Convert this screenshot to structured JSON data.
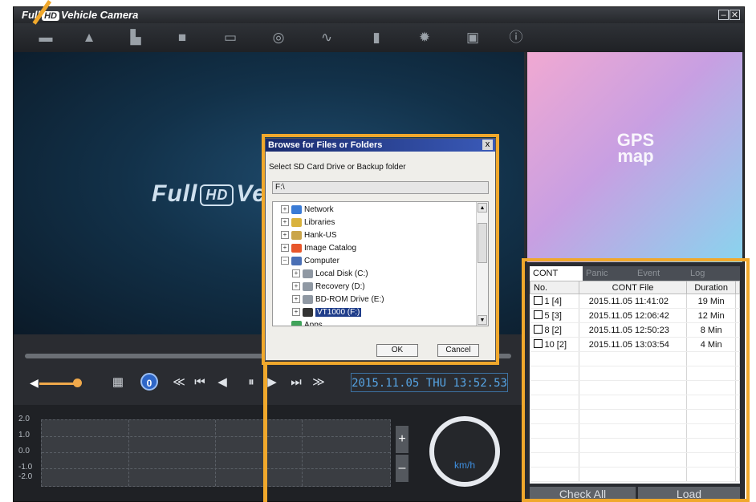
{
  "app": {
    "title_prefix": "Full",
    "title_hd": "HD",
    "title_suffix": "Vehicle Camera",
    "minimize_glyph": "–",
    "close_glyph": "✕"
  },
  "toolbar": {
    "icons": [
      "folder-icon",
      "image-icon",
      "printer-icon",
      "video-icon",
      "drive-icon",
      "globe-icon",
      "waveform-icon",
      "book-icon",
      "gear-icon",
      "photo-icon",
      "info-icon"
    ],
    "glyphs": [
      "▬",
      "▲",
      "▙",
      "■",
      "▭",
      "◎",
      "∿",
      "▮",
      "✹",
      "▣",
      "ⓘ"
    ]
  },
  "video": {
    "logo_prefix": "Full",
    "logo_hd": "HD",
    "logo_suffix": "Vehi"
  },
  "gps": {
    "label": "GPS\nmap"
  },
  "player": {
    "speed_badge": "0",
    "glyphs": {
      "volume": "◀",
      "snapshot": "▦",
      "rewind": "≪",
      "prev": "⏮",
      "step_back": "◀",
      "pause": "⏸",
      "play": "▶",
      "next": "⏭",
      "fast_forward": "≫"
    },
    "datetime": "2015.11.05 THU  13:52.53",
    "volume_level": 0.85
  },
  "gsensor": {
    "labels": [
      "2.0",
      "1.0",
      "0.0",
      "-1.0",
      "-2.0"
    ],
    "zoom_in": "+",
    "zoom_out": "–",
    "speed_unit": "km/h"
  },
  "list_panel": {
    "tabs": [
      "CONT",
      "Panic",
      "Event",
      "Log"
    ],
    "active_tab": "CONT",
    "columns": [
      "No.",
      "CONT File",
      "Duration"
    ],
    "rows": [
      {
        "no": "1 [4]",
        "file": "2015.11.05 11:41:02",
        "duration": "19 Min"
      },
      {
        "no": "5 [3]",
        "file": "2015.11.05 12:06:42",
        "duration": "12 Min"
      },
      {
        "no": "8 [2]",
        "file": "2015.11.05 12:50:23",
        "duration": "8 Min"
      },
      {
        "no": "10 [2]",
        "file": "2015.11.05 13:03:54",
        "duration": "4 Min"
      }
    ],
    "check_all": "Check All",
    "load": "Load"
  },
  "dialog": {
    "title": "Browse for Files or Folders",
    "close_glyph": "x",
    "prompt": "Select SD Card Drive or Backup folder",
    "path": "F:\\",
    "tree": [
      {
        "label": "Network",
        "expander": "+",
        "icon_color": "#3a7bd5"
      },
      {
        "label": "Libraries",
        "expander": "+",
        "icon_color": "#d9b23c"
      },
      {
        "label": "Hank-US",
        "expander": "+",
        "icon_color": "#caa54a"
      },
      {
        "label": "Image Catalog",
        "expander": "+",
        "icon_color": "#e8562b"
      },
      {
        "label": "Computer",
        "expander": "–",
        "icon_color": "#4a6fb5"
      },
      {
        "label": "Local Disk (C:)",
        "expander": "+",
        "icon_color": "#8f98a3"
      },
      {
        "label": "Recovery (D:)",
        "expander": "+",
        "icon_color": "#8f98a3"
      },
      {
        "label": "BD-ROM Drive (E:)",
        "expander": "+",
        "icon_color": "#8f98a3"
      },
      {
        "label": "VT1000 (F:)",
        "expander": "+",
        "icon_color": "#333333",
        "selected": true
      },
      {
        "label": "Apps",
        "expander": "",
        "icon_color": "#3fa35a"
      }
    ],
    "ok": "OK",
    "cancel": "Cancel"
  },
  "colors": {
    "highlight": "#f0a82c",
    "accent_blue": "#56a4e4",
    "app_bg": "#2a2c31"
  }
}
